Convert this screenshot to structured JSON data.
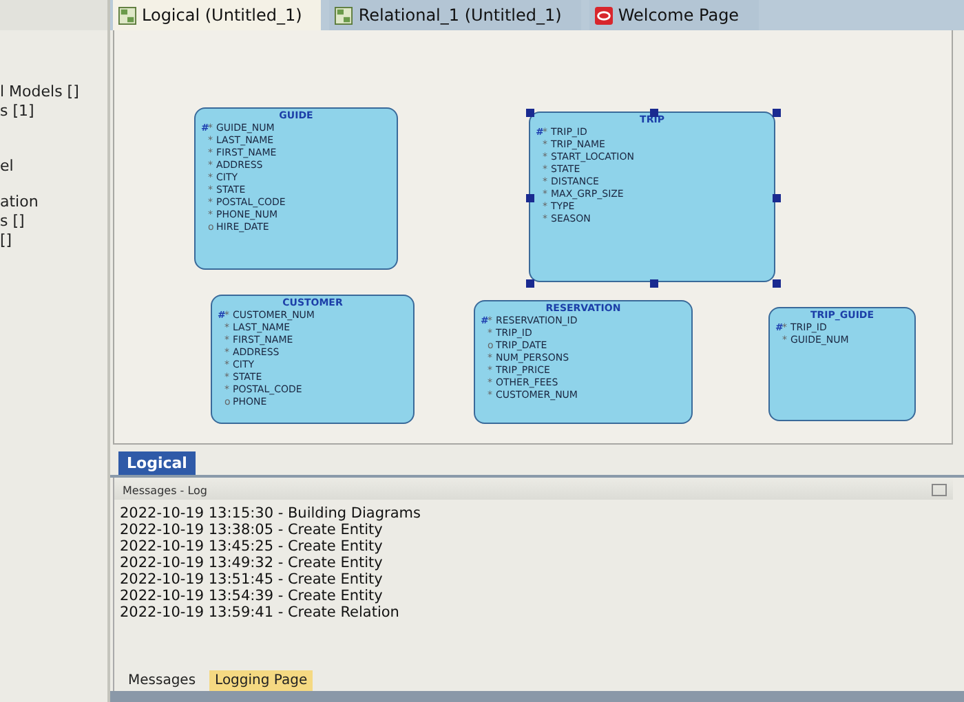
{
  "sidebar": {
    "items": [
      "l Models []",
      "s [1]",
      "el",
      "ation",
      "s []",
      "[]"
    ]
  },
  "tabs": [
    {
      "label": "Logical (Untitled_1)",
      "selected": true
    },
    {
      "label": "Relational_1 (Untitled_1)",
      "selected": false
    },
    {
      "label": "Welcome Page",
      "selected": false
    }
  ],
  "entities": [
    {
      "name": "GUIDE",
      "selected": false,
      "attributes": [
        {
          "pk": "#",
          "mark": "*",
          "name": "GUIDE_NUM"
        },
        {
          "mark": "*",
          "name": "LAST_NAME"
        },
        {
          "mark": "*",
          "name": "FIRST_NAME"
        },
        {
          "mark": "*",
          "name": "ADDRESS"
        },
        {
          "mark": "*",
          "name": "CITY"
        },
        {
          "mark": "*",
          "name": "STATE"
        },
        {
          "mark": "*",
          "name": "POSTAL_CODE"
        },
        {
          "mark": "*",
          "name": "PHONE_NUM"
        },
        {
          "mark": "o",
          "name": "HIRE_DATE"
        }
      ]
    },
    {
      "name": "TRIP",
      "selected": true,
      "attributes": [
        {
          "pk": "#",
          "mark": "*",
          "name": "TRIP_ID"
        },
        {
          "mark": "*",
          "name": "TRIP_NAME"
        },
        {
          "mark": "*",
          "name": "START_LOCATION"
        },
        {
          "mark": "*",
          "name": "STATE"
        },
        {
          "mark": "*",
          "name": "DISTANCE"
        },
        {
          "mark": "*",
          "name": "MAX_GRP_SIZE"
        },
        {
          "mark": "*",
          "name": "TYPE"
        },
        {
          "mark": "*",
          "name": "SEASON"
        }
      ]
    },
    {
      "name": "CUSTOMER",
      "selected": false,
      "attributes": [
        {
          "pk": "#",
          "mark": "*",
          "name": "CUSTOMER_NUM"
        },
        {
          "mark": "*",
          "name": "LAST_NAME"
        },
        {
          "mark": "*",
          "name": "FIRST_NAME"
        },
        {
          "mark": "*",
          "name": "ADDRESS"
        },
        {
          "mark": "*",
          "name": "CITY"
        },
        {
          "mark": "*",
          "name": "STATE"
        },
        {
          "mark": "*",
          "name": "POSTAL_CODE"
        },
        {
          "mark": "o",
          "name": "PHONE"
        }
      ]
    },
    {
      "name": "RESERVATION",
      "selected": false,
      "attributes": [
        {
          "pk": "#",
          "mark": "*",
          "name": "RESERVATION_ID"
        },
        {
          "mark": "*",
          "name": "TRIP_ID"
        },
        {
          "mark": "o",
          "name": "TRIP_DATE"
        },
        {
          "mark": "*",
          "name": "NUM_PERSONS"
        },
        {
          "mark": "*",
          "name": "TRIP_PRICE"
        },
        {
          "mark": "*",
          "name": "OTHER_FEES"
        },
        {
          "mark": "*",
          "name": "CUSTOMER_NUM"
        }
      ]
    },
    {
      "name": "TRIP_GUIDE",
      "selected": false,
      "attributes": [
        {
          "pk": "#",
          "mark": "*",
          "name": "TRIP_ID"
        },
        {
          "mark": "*",
          "name": "GUIDE_NUM"
        }
      ]
    }
  ],
  "diagram_tab": {
    "label": "Logical",
    "selected": true
  },
  "log": {
    "title": "Messages - Log",
    "lines": [
      "2022-10-19 13:15:30 - Building Diagrams",
      "2022-10-19 13:38:05 - Create Entity",
      "2022-10-19 13:45:25 - Create Entity",
      "2022-10-19 13:49:32 - Create Entity",
      "2022-10-19 13:51:45 - Create Entity",
      "2022-10-19 13:54:39 - Create Entity",
      "2022-10-19 13:59:41 - Create Relation"
    ]
  },
  "bottom_tabs": [
    {
      "label": "Messages",
      "selected": false
    },
    {
      "label": "Logging Page",
      "selected": true
    }
  ]
}
